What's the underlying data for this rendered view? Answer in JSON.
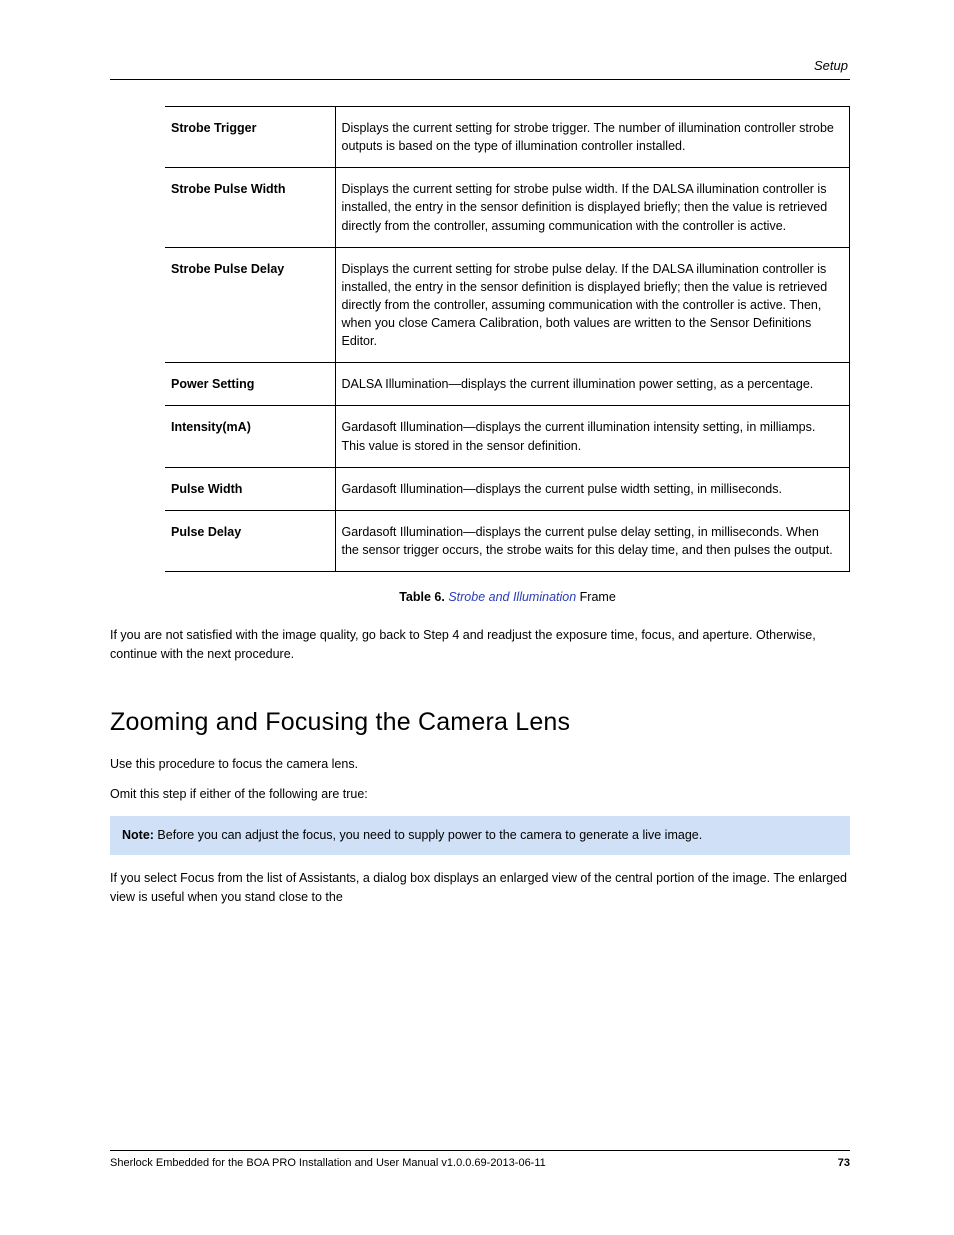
{
  "header": {
    "section": "Setup"
  },
  "table": {
    "rows": [
      {
        "label": "Strobe Trigger",
        "desc": "Displays the current setting for strobe trigger. The number of illumination controller strobe outputs is based on the type of illumination controller installed."
      },
      {
        "label": "Strobe Pulse Width",
        "desc": "Displays the current setting for strobe pulse width. If the DALSA illumination controller is installed, the entry in the sensor definition is displayed briefly; then the value is retrieved directly from the controller, assuming communication with the controller is active."
      },
      {
        "label": "Strobe Pulse Delay",
        "desc": "Displays the current setting for strobe pulse delay. If the DALSA illumination controller is installed, the entry in the sensor definition is displayed briefly; then the value is retrieved directly from the controller, assuming communication with the controller is active. Then, when you close Camera Calibration, both values are written to the Sensor Definitions Editor."
      },
      {
        "label": "Power Setting",
        "desc": "DALSA Illumination—displays the current illumination power setting, as a percentage."
      },
      {
        "label": "Intensity(mA)",
        "desc": "Gardasoft Illumination—displays the current illumination intensity setting, in milliamps. This value is stored in the sensor definition."
      },
      {
        "label": "Pulse Width",
        "desc": "Gardasoft Illumination—displays the current pulse width setting, in milliseconds."
      },
      {
        "label": "Pulse Delay",
        "desc": "Gardasoft Illumination—displays the current pulse delay setting, in milliseconds. When the sensor trigger occurs, the strobe waits for this delay time, and then pulses the output."
      }
    ]
  },
  "caption": {
    "number": "Table 6.",
    "link_text": "Strobe and Illumination",
    "suffix": " Frame"
  },
  "after_table": "If you are not satisfied with the image quality, go back to Step 4 and readjust the exposure time, focus, and aperture. Otherwise, continue with the next procedure.",
  "section_heading": "Zooming and Focusing the Camera Lens",
  "body1": "Use this procedure to focus the camera lens.",
  "body2": "Omit this step if either of the following are true:",
  "note": {
    "prefix": "Note: ",
    "text": "Before you can adjust the focus, you need to supply power to the camera to generate a live image."
  },
  "below_note": "If you select Focus from the list of Assistants, a dialog box displays an enlarged view of the central portion of the image. The enlarged view is useful when you stand close to the",
  "footer": {
    "doc": "Sherlock Embedded for the BOA PRO Installation and User Manual v1.0.0.69-2013-06-11",
    "page": "73"
  }
}
